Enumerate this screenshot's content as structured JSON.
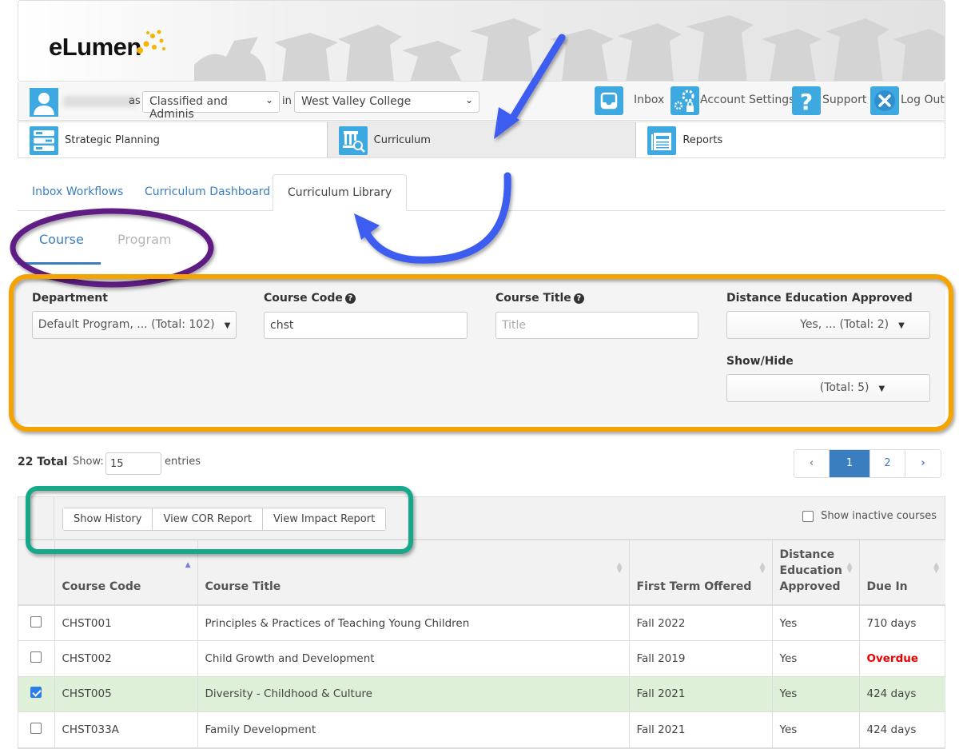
{
  "header": {
    "logo_text": "eLumen",
    "user": {
      "as_label": "as",
      "role_selected": "Classified and Adminis",
      "in_label": "in",
      "college_selected": "West Valley College"
    },
    "links": [
      {
        "label": "Inbox",
        "icon": "inbox-icon"
      },
      {
        "label": "Account Settings",
        "icon": "gear-lock-icon"
      },
      {
        "label": "Support",
        "icon": "question-icon"
      },
      {
        "label": "Log Out",
        "icon": "close-icon"
      }
    ],
    "modules": [
      {
        "label": "Strategic Planning",
        "icon": "strategic-planning-icon",
        "active": false
      },
      {
        "label": "Curriculum",
        "icon": "curriculum-icon",
        "active": true
      },
      {
        "label": "Reports",
        "icon": "reports-icon",
        "active": false
      }
    ]
  },
  "tabs": [
    {
      "label": "Inbox Workflows",
      "active": false
    },
    {
      "label": "Curriculum Dashboard",
      "active": false
    },
    {
      "label": "Curriculum Library",
      "active": true
    }
  ],
  "subtabs": [
    {
      "label": "Course",
      "active": true
    },
    {
      "label": "Program",
      "active": false
    }
  ],
  "filters": {
    "department": {
      "label": "Department",
      "value": "Default Program, ... (Total: 102)"
    },
    "course_code": {
      "label": "Course Code",
      "value": "chst",
      "help": "?"
    },
    "course_title": {
      "label": "Course Title",
      "value": "",
      "placeholder": "Title",
      "help": "?"
    },
    "distance_ed": {
      "label": "Distance Education Approved",
      "value": "Yes, ... (Total: 2)"
    },
    "show_hide": {
      "label": "Show/Hide",
      "value": "(Total: 5)"
    }
  },
  "list_controls": {
    "total": "22 Total",
    "show_label": "Show:",
    "show_value": "15",
    "entries_label": "entries",
    "pagination": {
      "prev": "‹",
      "pages": [
        "1",
        "2"
      ],
      "current": "1",
      "next": "›"
    }
  },
  "toolbar": {
    "buttons": [
      "Show History",
      "View COR Report",
      "View Impact Report"
    ],
    "show_inactive_label": "Show inactive courses",
    "show_inactive_checked": false
  },
  "table": {
    "columns": [
      "Course Code",
      "Course Title",
      "First Term Offered",
      "Distance Education Approved",
      "Due In"
    ],
    "rows": [
      {
        "checked": false,
        "code": "CHST001",
        "title": "Principles & Practices of Teaching Young Children",
        "term": "Fall 2022",
        "de": "Yes",
        "due": "710 days",
        "overdue": false
      },
      {
        "checked": false,
        "code": "CHST002",
        "title": "Child Growth and Development",
        "term": "Fall 2019",
        "de": "Yes",
        "due": "Overdue",
        "overdue": true
      },
      {
        "checked": true,
        "code": "CHST005",
        "title": "Diversity - Childhood & Culture",
        "term": "Fall 2021",
        "de": "Yes",
        "due": "424 days",
        "overdue": false
      },
      {
        "checked": false,
        "code": "CHST033A",
        "title": "Family Development",
        "term": "Fall 2021",
        "de": "Yes",
        "due": "424 days",
        "overdue": false
      }
    ]
  },
  "colors": {
    "accent_blue": "#3a7ec0",
    "icon_blue": "#3ea9e0",
    "selected_row": "#dff0d8",
    "overdue_red": "#e00000",
    "annotation_purple": "#5e1f84",
    "annotation_orange": "#f5a300",
    "annotation_green": "#12a889",
    "annotation_arrow": "#3d5bf0"
  }
}
